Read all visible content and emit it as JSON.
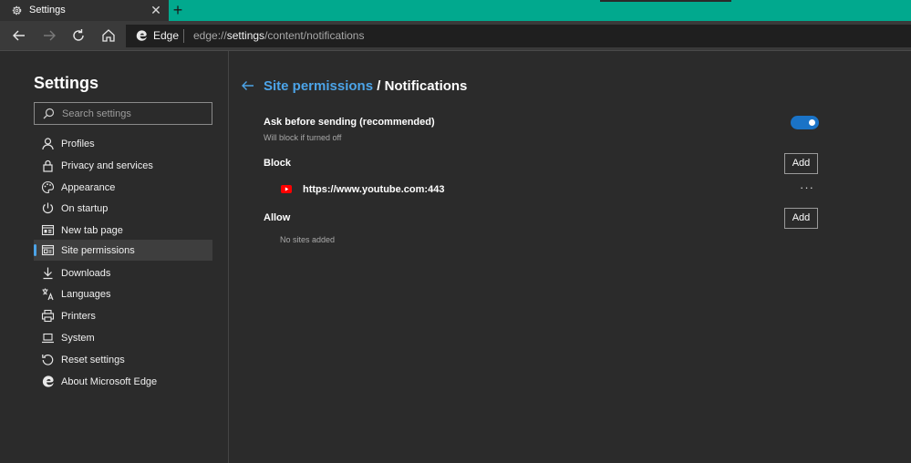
{
  "tab": {
    "title": "Settings",
    "close": "✕",
    "new_tab": "+"
  },
  "address": {
    "site_name": "Edge",
    "url_prefix": "edge://",
    "url_host": "settings",
    "url_path": "/content/notifications"
  },
  "sidebar": {
    "title": "Settings",
    "search_placeholder": "Search settings",
    "items": [
      {
        "label": "Profiles",
        "icon": "person-icon"
      },
      {
        "label": "Privacy and services",
        "icon": "lock-icon"
      },
      {
        "label": "Appearance",
        "icon": "palette-icon"
      },
      {
        "label": "On startup",
        "icon": "power-icon"
      },
      {
        "label": "New tab page",
        "icon": "newtab-grid-icon"
      },
      {
        "label": "Site permissions",
        "icon": "site-permissions-icon",
        "selected": true
      },
      {
        "label": "Downloads",
        "icon": "download-icon"
      },
      {
        "label": "Languages",
        "icon": "languages-icon"
      },
      {
        "label": "Printers",
        "icon": "printer-icon"
      },
      {
        "label": "System",
        "icon": "laptop-icon"
      },
      {
        "label": "Reset settings",
        "icon": "reset-icon"
      },
      {
        "label": "About Microsoft Edge",
        "icon": "edge-logo-icon"
      }
    ]
  },
  "main": {
    "breadcrumb": "Site permissions",
    "separator": "/",
    "title": "Notifications",
    "ask": {
      "label": "Ask before sending (recommended)",
      "sub": "Will block if turned off",
      "enabled": true
    },
    "block": {
      "label": "Block",
      "add_label": "Add",
      "sites": [
        {
          "url": "https://www.youtube.com:443",
          "icon": "youtube-icon",
          "more": "···"
        }
      ]
    },
    "allow": {
      "label": "Allow",
      "add_label": "Add",
      "empty": "No sites added"
    }
  },
  "colors": {
    "tab_strip": "#01a98e",
    "accent": "#4ca4e8",
    "toggle_on": "#1a73c7",
    "background": "#2b2b2b"
  }
}
